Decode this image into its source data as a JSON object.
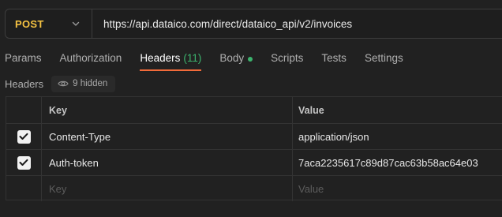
{
  "request": {
    "method": "POST",
    "url": "https://api.dataico.com/direct/dataico_api/v2/invoices"
  },
  "tabs": [
    {
      "label": "Params"
    },
    {
      "label": "Authorization"
    },
    {
      "label": "Headers",
      "count": "(11)"
    },
    {
      "label": "Body"
    },
    {
      "label": "Scripts"
    },
    {
      "label": "Tests"
    },
    {
      "label": "Settings"
    }
  ],
  "headers_section": {
    "title": "Headers",
    "hidden_label": "9 hidden"
  },
  "table": {
    "columns": {
      "key": "Key",
      "value": "Value"
    },
    "rows": [
      {
        "key": "Content-Type",
        "value": "application/json",
        "checked": true
      },
      {
        "key": "Auth-token",
        "value": "7aca2235617c89d87cac63b58ac64e03",
        "checked": true
      }
    ],
    "placeholder": {
      "key": "Key",
      "value": "Value"
    }
  },
  "colors": {
    "method": "#f5c242",
    "active_tab_underline": "#f26b3a",
    "count_green": "#3cb46e",
    "background": "#212121"
  }
}
